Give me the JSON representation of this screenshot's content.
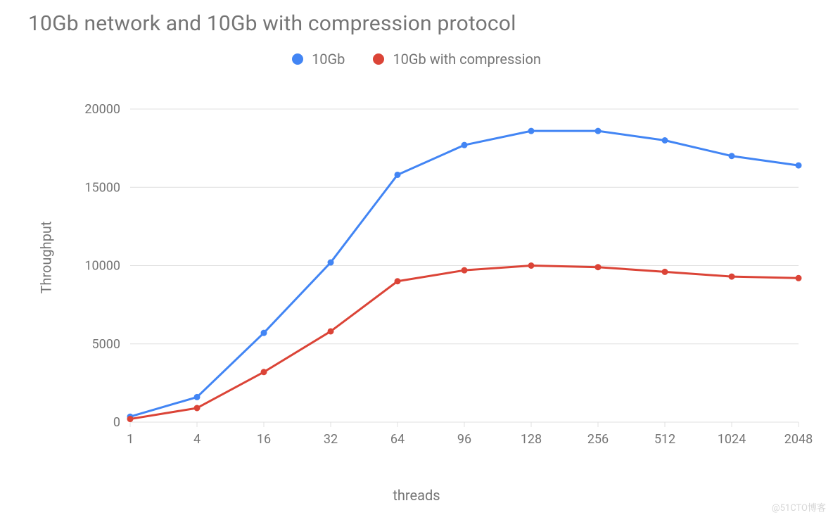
{
  "chart_data": {
    "type": "line",
    "title": "10Gb network and 10Gb with compression protocol",
    "xlabel": "threads",
    "ylabel": "Throughput",
    "categories": [
      "1",
      "4",
      "16",
      "32",
      "64",
      "96",
      "128",
      "256",
      "512",
      "1024",
      "2048"
    ],
    "y_ticks": [
      0,
      5000,
      10000,
      15000,
      20000
    ],
    "ylim": [
      0,
      20000
    ],
    "series": [
      {
        "name": "10Gb",
        "color": "#4285F4",
        "values": [
          350,
          1600,
          5700,
          10200,
          15800,
          17700,
          18600,
          18600,
          18000,
          17000,
          16400
        ]
      },
      {
        "name": "10Gb with compression",
        "color": "#DB4437",
        "values": [
          200,
          900,
          3200,
          5800,
          9000,
          9700,
          10000,
          9900,
          9600,
          9300,
          9200
        ]
      }
    ],
    "legend_position": "top_center"
  },
  "watermark": "@51CTO博客"
}
